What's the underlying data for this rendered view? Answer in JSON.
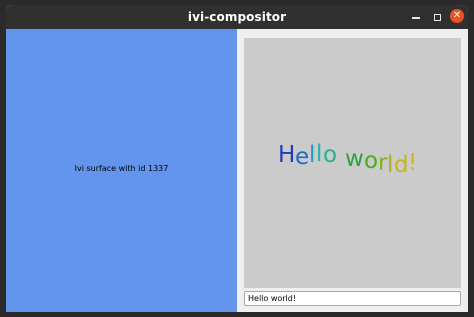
{
  "window": {
    "title": "ivi-compositor",
    "controls": {
      "minimize_icon": "minimize-icon",
      "maximize_icon": "maximize-icon",
      "close_icon": "close-icon",
      "close_glyph": "✕"
    }
  },
  "left_surface": {
    "label": "Ivi surface with id 1337",
    "background": "#6495ed"
  },
  "right_surface": {
    "canvas_background": "#cbcbcb",
    "hello_letters": [
      {
        "char": "H",
        "color": "#1f3fb5"
      },
      {
        "char": "e",
        "color": "#1b6cc4"
      },
      {
        "char": "l",
        "color": "#1f9bc9"
      },
      {
        "char": "l",
        "color": "#1fb6b0"
      },
      {
        "char": "o",
        "color": "#22b58a"
      },
      {
        "char": " ",
        "color": "#000000"
      },
      {
        "char": "w",
        "color": "#2aa53e"
      },
      {
        "char": "o",
        "color": "#4bac1d"
      },
      {
        "char": "r",
        "color": "#7fb41a"
      },
      {
        "char": "l",
        "color": "#a6b41a"
      },
      {
        "char": "d",
        "color": "#c8b417"
      },
      {
        "char": "!",
        "color": "#d9b613"
      }
    ],
    "input": {
      "value": "Hello world!",
      "placeholder": ""
    }
  }
}
